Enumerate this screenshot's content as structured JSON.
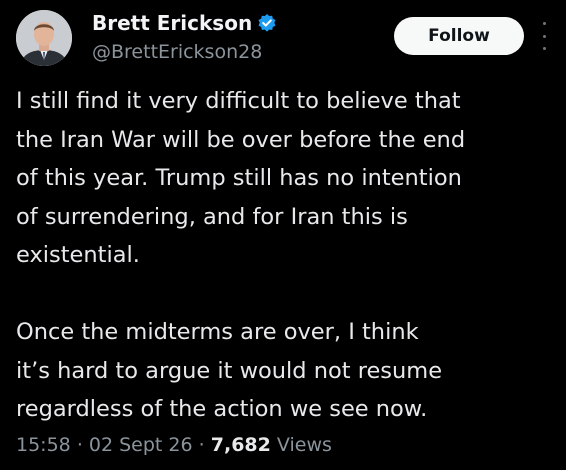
{
  "author": {
    "name": "Brett Erickson",
    "handle": "@BrettErickson28",
    "verified": true
  },
  "follow_label": "Follow",
  "tweet": {
    "paragraph1": [
      "I still find it very difficult to believe that",
      "the Iran War will be over before the end",
      "of this year. Trump still has no intention",
      "of surrendering, and for Iran this is",
      "existential."
    ],
    "paragraph2": [
      "Once the midterms are over, I think",
      "it’s hard to argue it would not resume",
      "regardless of the action we see now."
    ]
  },
  "meta": {
    "time": "15:58",
    "sep1": "·",
    "date": "02 Sept 26",
    "sep2": "·",
    "views_count": "7,682",
    "views_label": "Views"
  },
  "colors": {
    "background": "#000000",
    "text": "#e7e9ea",
    "secondary": "#8b949b",
    "verified": "#1d9bf0",
    "follow_bg": "#f7f9f9"
  },
  "icons": {
    "verified": "verified-badge-icon",
    "more": "more-options-icon"
  }
}
